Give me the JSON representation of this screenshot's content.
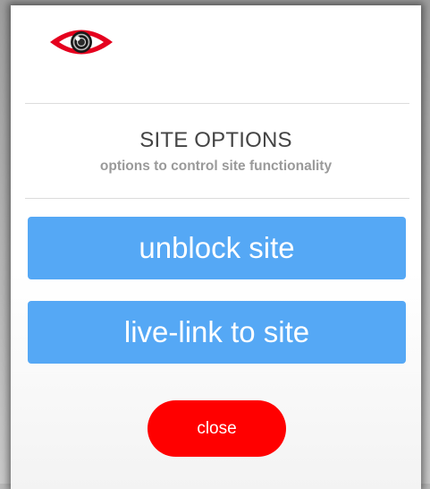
{
  "header": {
    "logo_icon": "eye-icon",
    "logo_color": "#e5001e"
  },
  "section": {
    "title": "SITE OPTIONS",
    "subtitle": "options to control site functionality"
  },
  "actions": {
    "unblock_label": "unblock site",
    "livelink_label": "live-link to site",
    "close_label": "close"
  },
  "colors": {
    "button_blue": "#55a8f5",
    "close_red": "#ff0000",
    "title_text": "#444444",
    "subtitle_text": "#9a9a9a"
  }
}
